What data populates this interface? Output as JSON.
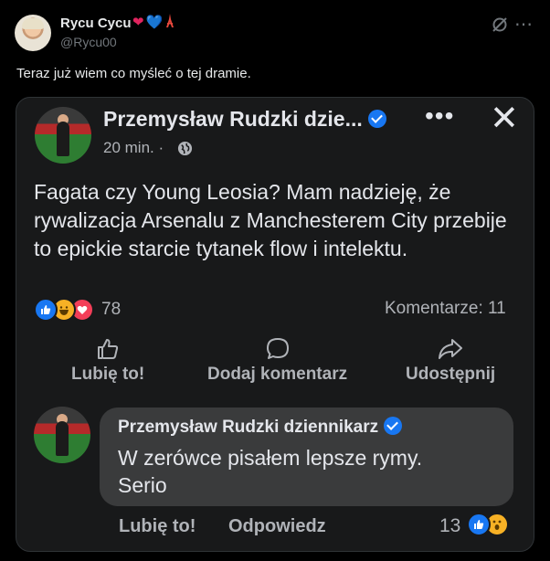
{
  "tweet": {
    "author_name": "Rycu Cycu",
    "author_emojis": [
      "❤",
      "💙",
      "🗼"
    ],
    "handle": "@Rycu00",
    "text": "Teraz już wiem co myśleć o tej dramie.",
    "icons": [
      "grok-icon",
      "more-icon"
    ]
  },
  "fb_post": {
    "author": "Przemysław Rudzki dzie...",
    "time": "20 min. ·",
    "text": "Fagata czy Young Leosia? Mam nadzieję, że rywalizacja Arsenalu z Manchesterem City przebije to epickie starcie tytanek flow i intelektu.",
    "reaction_count": "78",
    "comments": "Komentarze: 11",
    "actions": {
      "like": "Lubię to!",
      "comment": "Dodaj komentarz",
      "share": "Udostępnij"
    }
  },
  "comment": {
    "author": "Przemysław Rudzki dziennikarz",
    "text_line1": "W zerówce pisałem lepsze rymy.",
    "text_line2": "Serio",
    "like": "Lubię to!",
    "reply": "Odpowiedz",
    "reaction_count": "13"
  },
  "colors": {
    "fb_blue": "#1877f2",
    "card_bg": "#18191a",
    "bubble_bg": "#3a3b3c"
  }
}
